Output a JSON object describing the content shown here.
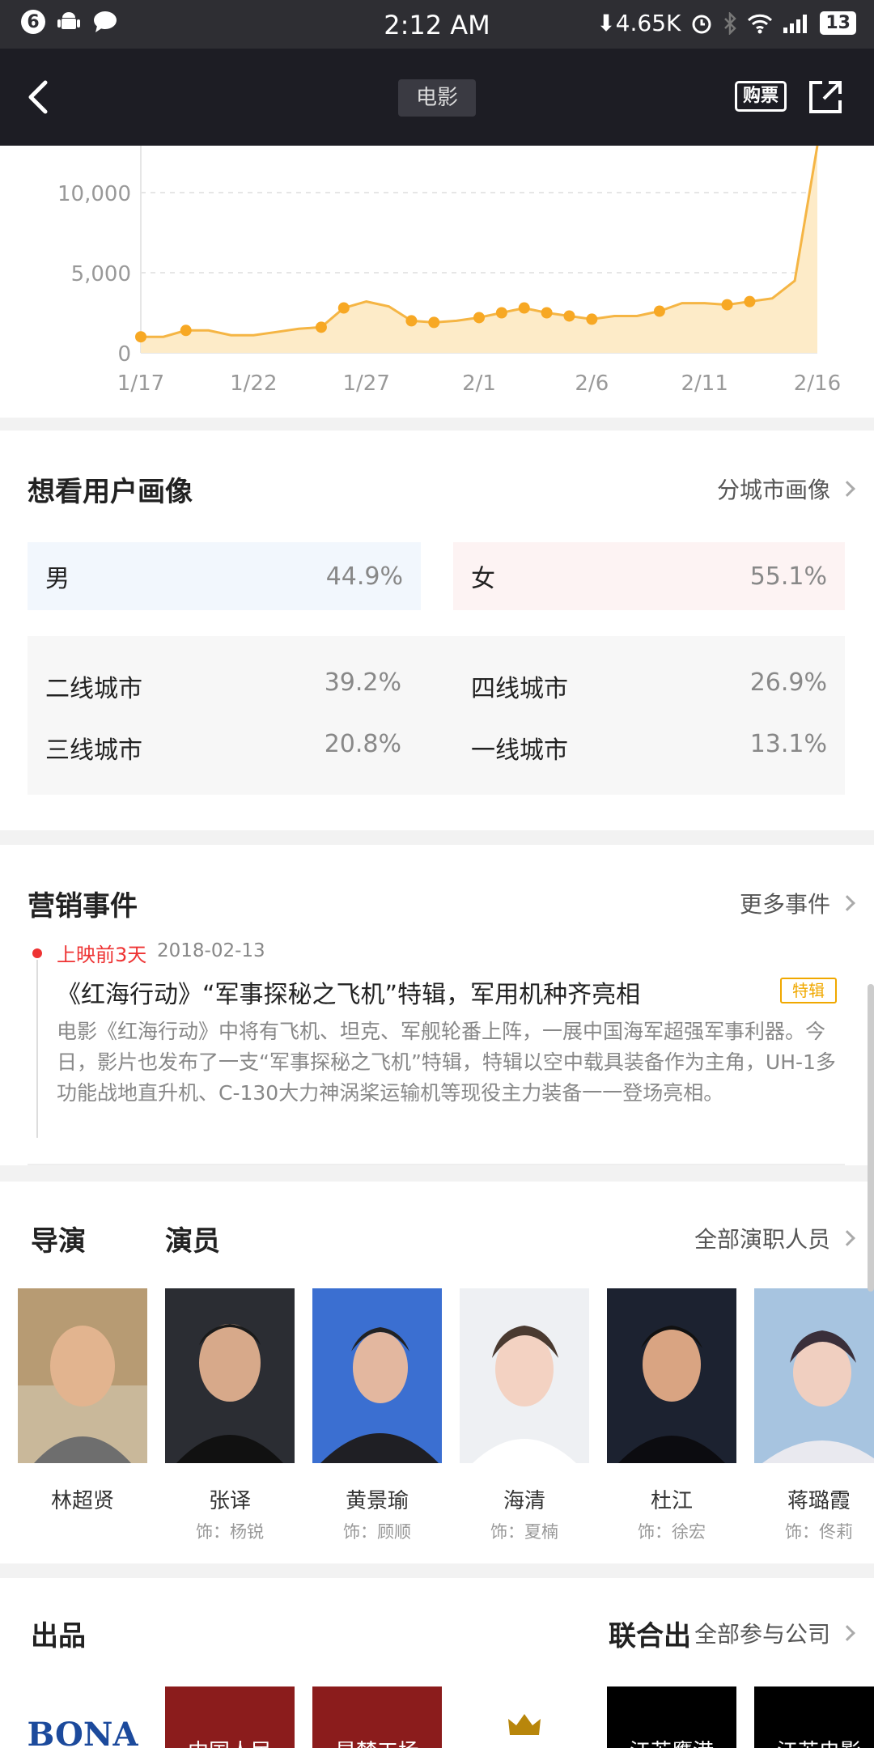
{
  "status_bar": {
    "notif_count": "6",
    "time": "2:12 AM",
    "speed": "⬇4.65K",
    "battery": "13"
  },
  "nav": {
    "title": "电影",
    "buy": "购票"
  },
  "chart_data": {
    "type": "area",
    "x_ticks": [
      "1/17",
      "1/22",
      "1/27",
      "2/1",
      "2/6",
      "2/11",
      "2/16"
    ],
    "y_ticks": [
      "0",
      "5,000",
      "10,000"
    ],
    "ylim": [
      0,
      12500
    ],
    "grid": true,
    "series": [
      {
        "x": [
          "1/17",
          "1/18",
          "1/19",
          "1/20",
          "1/21",
          "1/22",
          "1/23",
          "1/24",
          "1/25",
          "1/26",
          "1/27",
          "1/28",
          "1/29",
          "1/30",
          "1/31",
          "2/1",
          "2/2",
          "2/3",
          "2/4",
          "2/5",
          "2/6",
          "2/7",
          "2/8",
          "2/9",
          "2/10",
          "2/11",
          "2/12",
          "2/13",
          "2/14",
          "2/15",
          "2/16"
        ],
        "values": [
          1000,
          1000,
          1400,
          1400,
          1100,
          1100,
          1300,
          1500,
          1600,
          2800,
          3200,
          2900,
          2000,
          1900,
          2000,
          2200,
          2500,
          2800,
          2500,
          2300,
          2100,
          2300,
          2300,
          2600,
          3100,
          3100,
          3000,
          3200,
          3400,
          4500,
          13000
        ],
        "markers": [
          0,
          2,
          8,
          9,
          12,
          13,
          15,
          16,
          17,
          18,
          19,
          20,
          23,
          26,
          27
        ]
      }
    ]
  },
  "audience": {
    "title": "想看用户画像",
    "more": "分城市画像",
    "male_label": "男",
    "male_value": "44.9%",
    "female_label": "女",
    "female_value": "55.1%",
    "cities": [
      {
        "label": "二线城市",
        "value": "39.2%"
      },
      {
        "label": "四线城市",
        "value": "26.9%"
      },
      {
        "label": "三线城市",
        "value": "20.8%"
      },
      {
        "label": "一线城市",
        "value": "13.1%"
      }
    ]
  },
  "marketing": {
    "title": "营销事件",
    "more": "更多事件",
    "event": {
      "when": "上映前3天",
      "date": "2018-02-13",
      "title": "《红海行动》“军事探秘之飞机”特辑，军用机种齐亮相",
      "tag": "特辑",
      "desc": "电影《红海行动》中将有飞机、坦克、军舰轮番上阵，一展中国海军超强军事利器。今日，影片也发布了一支“军事探秘之飞机”特辑，特辑以空中载具装备作为主角，UH-1多功能战地直升机、C-130大力神涡桨运输机等现役主力装备一一登场亮相。"
    }
  },
  "cast": {
    "director_tab": "导演",
    "actor_tab": "演员",
    "more": "全部演职人员",
    "people": [
      {
        "name": "林超贤",
        "role": ""
      },
      {
        "name": "张译",
        "role": "饰：杨锐"
      },
      {
        "name": "黄景瑜",
        "role": "饰：顾顺"
      },
      {
        "name": "海清",
        "role": "饰：夏楠"
      },
      {
        "name": "杜江",
        "role": "饰：徐宏"
      },
      {
        "name": "蒋璐霞",
        "role": "饰：佟莉"
      }
    ]
  },
  "production": {
    "title": "出品",
    "co_title": "联合出",
    "more": "全部参与公司",
    "companies": [
      "BONA",
      "中国人民",
      "星梦工场",
      "",
      "江苏鹰港",
      "江苏电影"
    ]
  }
}
